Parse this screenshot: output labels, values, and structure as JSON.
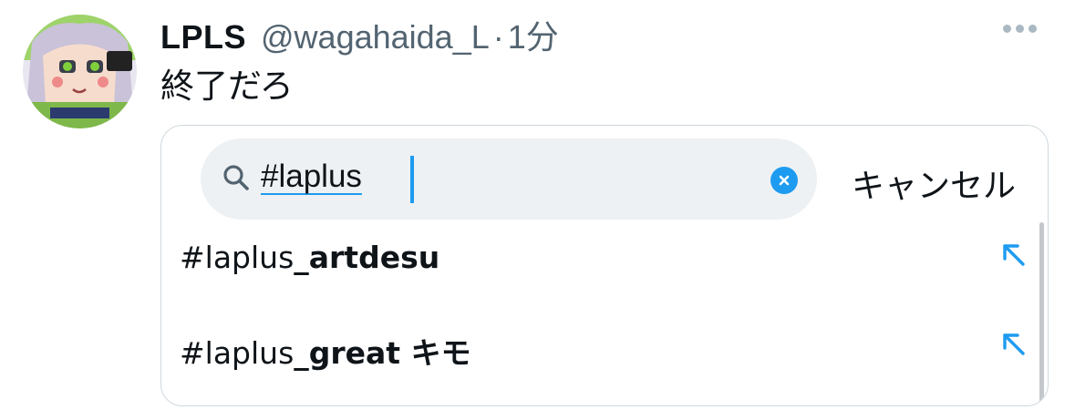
{
  "tweet": {
    "display_name": "LPLS",
    "handle": "@wagahaida_L",
    "separator": "·",
    "time": "1分",
    "text": "終了だろ"
  },
  "icons": {
    "avatar": "avatar-image",
    "more": "more-dots-icon",
    "search": "search-icon",
    "clear": "clear-x-icon",
    "fill_arrow": "arrow-up-left-icon"
  },
  "search": {
    "query": "#laplus",
    "cancel_label": "キャンセル"
  },
  "suggestions": [
    {
      "prefix": "#laplus",
      "completion": "_artdesu"
    },
    {
      "prefix": "#laplus",
      "completion": "_great キモ"
    }
  ],
  "colors": {
    "accent": "#1d9bf0",
    "secondary_text": "#536471",
    "search_bg": "#eef1f3",
    "border": "#cfd9de"
  }
}
